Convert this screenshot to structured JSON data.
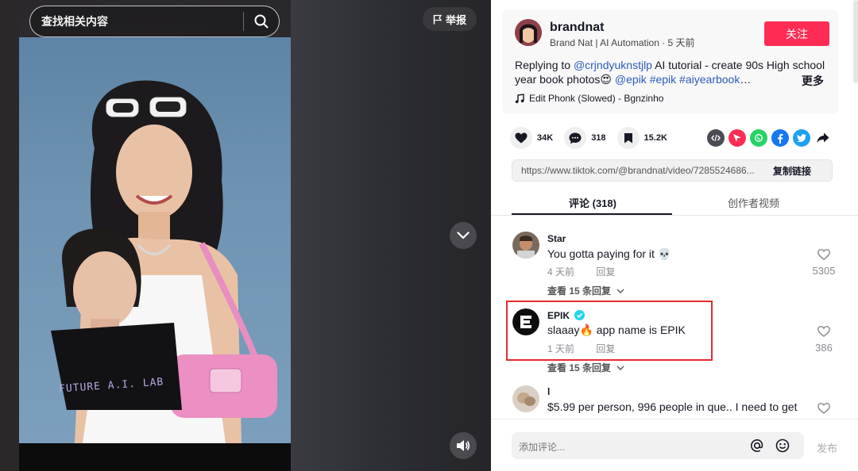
{
  "search": {
    "placeholder": "查找相关内容"
  },
  "report": {
    "label": "举报"
  },
  "author": {
    "name": "brandnat",
    "subtitle": "Brand Nat | AI Automation · 5 天前",
    "follow_label": "关注"
  },
  "description": {
    "prefix": "Replying to ",
    "mention": "@crjndyuknstjlp",
    "middle": " AI tutorial - create 90s High school year book photos",
    "emoji": "😍",
    "tag1": " @epik",
    "tag2": " #epik",
    "tag3": " #aiyearbook",
    "ellipsis": "…",
    "more_label": "更多"
  },
  "music": {
    "label": "Edit Phonk (Slowed) - Bgnzinho",
    "icon": "music-note-icon"
  },
  "actions": {
    "likes": "34K",
    "comments": "318",
    "saves": "15.2K"
  },
  "share": {
    "icons": [
      "embed-icon",
      "send-icon",
      "whatsapp-icon",
      "facebook-icon",
      "twitter-icon",
      "share-arrow-icon"
    ],
    "colors": {
      "send": "#fe2c55",
      "whatsapp": "#25d366",
      "facebook": "#1877f2",
      "twitter": "#1da1f2"
    }
  },
  "url": {
    "text": "https://www.tiktok.com/@brandnat/video/7285524686...",
    "copy_label": "复制链接"
  },
  "tabs": {
    "comments": "评论 (318)",
    "creator_videos": "创作者视频"
  },
  "video_overlay_text": "FUTURE A.I. LAB",
  "comments": [
    {
      "user": "Star",
      "text": "You gotta paying for it 💀",
      "time": "4 天前",
      "reply_label": "回复",
      "likes": "5305",
      "view_replies": "查看 15 条回复"
    },
    {
      "user": "EPIK",
      "verified": true,
      "text": "slaaay🔥 app name is EPIK",
      "time": "1 天前",
      "reply_label": "回复",
      "likes": "386",
      "view_replies": "查看 15 条回复"
    },
    {
      "user": "l",
      "text": "$5.99 per person, 996 people in que.. I need to get"
    }
  ],
  "input": {
    "placeholder": "添加评论...",
    "publish_label": "发布"
  },
  "colors": {
    "accent": "#fe2c55",
    "link": "#2b5db9",
    "highlight_box": "#e32c2c",
    "verified": "#20d5ec"
  }
}
